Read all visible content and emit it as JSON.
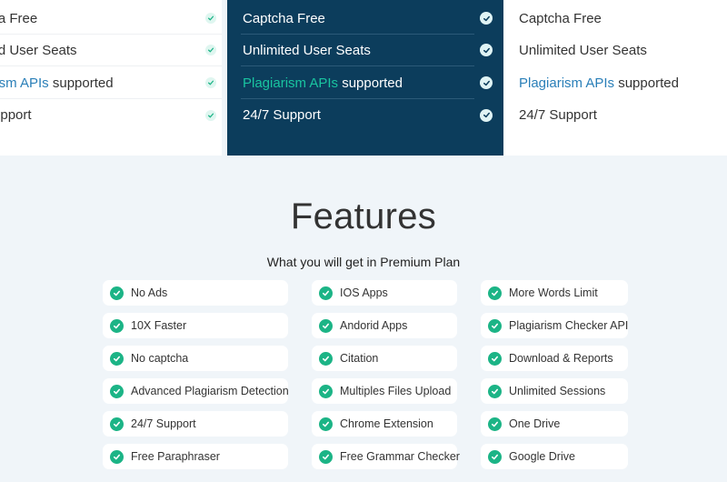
{
  "pricing": {
    "left_rows": [
      {
        "text": "cha Free",
        "link": "",
        "rest": ""
      },
      {
        "text": "ited User Seats",
        "link": "",
        "rest": ""
      },
      {
        "text": "",
        "link": "arism APIs",
        "rest": " supported"
      },
      {
        "text": "Support",
        "link": "",
        "rest": ""
      }
    ],
    "mid_rows": [
      {
        "text": "Captcha Free",
        "link": "",
        "rest": ""
      },
      {
        "text": "Unlimited User Seats",
        "link": "",
        "rest": ""
      },
      {
        "text": "",
        "link": "Plagiarism APIs",
        "rest": " supported"
      },
      {
        "text": "24/7 Support",
        "link": "",
        "rest": ""
      }
    ],
    "right_rows": [
      {
        "text": "Captcha Free",
        "link": "",
        "rest": ""
      },
      {
        "text": "Unlimited User Seats",
        "link": "",
        "rest": ""
      },
      {
        "text": "",
        "link": "Plagiarism APIs",
        "rest": " supported"
      },
      {
        "text": "24/7 Support",
        "link": "",
        "rest": ""
      }
    ]
  },
  "features": {
    "title": "Features",
    "subtitle": "What you will get in Premium Plan",
    "col1": [
      "No Ads",
      "10X Faster",
      "No captcha",
      "Advanced Plagiarism Detection",
      "24/7 Support",
      "Free Paraphraser"
    ],
    "col2": [
      "IOS Apps",
      "Andorid Apps",
      "Citation",
      "Multiples Files Upload",
      "Chrome Extension",
      "Free Grammar Checker"
    ],
    "col3": [
      "More Words Limit",
      "Plagiarism Checker API",
      "Download & Reports",
      "Unlimited Sessions",
      "One Drive",
      "Google Drive"
    ]
  },
  "colors": {
    "accent_green": "#1cb486",
    "highlight_card": "#0c3d5c",
    "link_blue": "#2a7fb8",
    "link_teal": "#19c4a0"
  },
  "icons": {
    "check": "check-circle-icon"
  }
}
